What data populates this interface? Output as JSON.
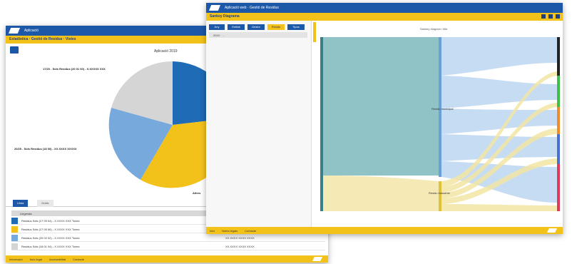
{
  "back_window": {
    "topbar_text": "Aplicació",
    "title": "Estadística · Gestió de Residus · Vistes",
    "chart_title": "Aplicació 2019",
    "slice_labels": {
      "top_left": "17/20 - Sòls Residus (20 01 00) - X.XXXXX XXX",
      "left": "20/25 - Sòls Residus (18 00) - XX.XXXX XXXXX",
      "bottom_right": "Altres"
    },
    "tabs": [
      "Llista",
      "Gràfic"
    ],
    "legend_header": "Llegenda",
    "legend_rows": [
      {
        "label": "Residus Sòls (17 05 04) - X.XXXX XXX Tones",
        "value": "XX.XXXX XXXX XXXX",
        "color": "#1f6bb5"
      },
      {
        "label": "Residus Sòls (17 05 06) - X.XXXX XXX Tones",
        "value": "XX.XXXX XXXX XXXX",
        "color": "#f3c21a"
      },
      {
        "label": "Residus Sòls (20 02 02) - X.XXXX XXX Tones",
        "value": "XX.XXXX XXXX XXXX",
        "color": "#78a9dc"
      },
      {
        "label": "Residus Sòls (18 01 04) - X.XXXX XXX Tones",
        "value": "XX.XXXX XXXX XXXX",
        "color": "#d5d5d5"
      }
    ],
    "footer_links": [
      "Informació",
      "Avís legal",
      "Accessibilitat",
      "Contacte"
    ]
  },
  "front_window": {
    "topbar_text": "Aplicació web · Gestió de Residus",
    "title": "Sankey Diagrama",
    "buttons": [
      "Any",
      "Entitat",
      "Gestor",
      "Residu",
      "Tipus"
    ],
    "selected_button": "Residu",
    "filter_text": "2019 · ...",
    "sankey_title": "Sankey diagram / title",
    "node_labels": {
      "mid_top": "Residu municipal",
      "mid_bottom": "Residu industrial"
    },
    "footer_links": [
      "Inici",
      "Notes legals",
      "Contacte"
    ]
  },
  "colors": {
    "blue": "#1d57a8",
    "yellow": "#f3c21a",
    "pie_blue": "#1f6bb5",
    "pie_yellow": "#f3c21a",
    "pie_light_blue": "#78a9dc",
    "pie_gray": "#d5d5d5",
    "sankey_teal": "#8fc3c6",
    "sankey_flow_blue": "#c6dcf3",
    "sankey_flow_yellow": "#f2e5a3"
  }
}
